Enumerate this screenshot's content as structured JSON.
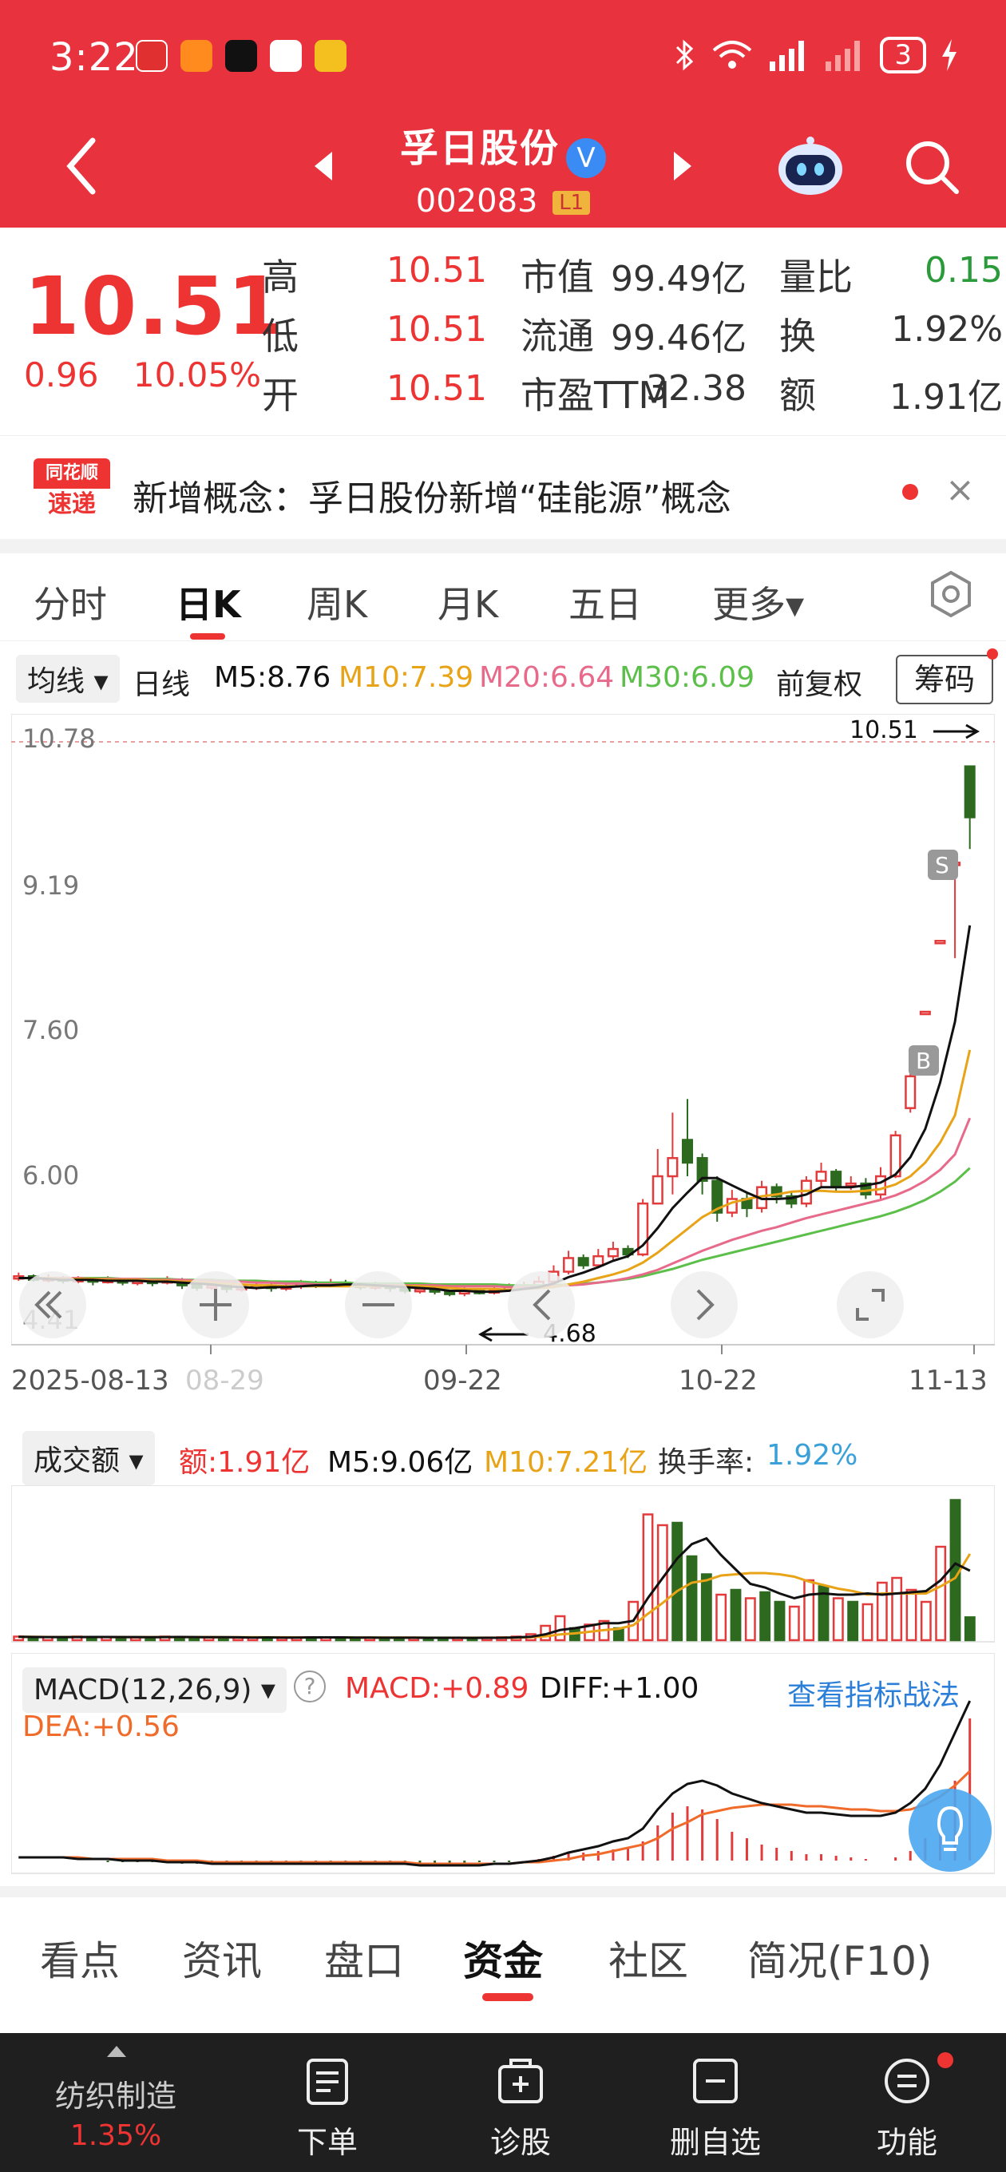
{
  "status_bar": {
    "time": "3:22",
    "battery": "3"
  },
  "header": {
    "stock_name": "孚日股份",
    "verify_mark": "V",
    "stock_code": "002083",
    "level_badge": "L1"
  },
  "quote": {
    "price": "10.51",
    "change": "0.96",
    "change_pct": "10.05%",
    "fields": {
      "high_label": "高",
      "high_value": "10.51",
      "low_label": "低",
      "low_value": "10.51",
      "open_label": "开",
      "open_value": "10.51",
      "mcap_label": "市值",
      "mcap_value": "99.49亿",
      "float_label": "流通",
      "float_value": "99.46亿",
      "pe_label": "市盈TTM",
      "pe_value": "32.38",
      "vr_label": "量比",
      "vr_value": "0.15",
      "turn_label": "换",
      "turn_value": "1.92%",
      "amt_label": "额",
      "amt_value": "1.91亿"
    }
  },
  "news": {
    "logo_line1": "同花顺",
    "logo_line2": "速递",
    "text": "新增概念：孚日股份新增“硅能源”概念",
    "close": "×"
  },
  "period_tabs": [
    "分时",
    "日K",
    "周K",
    "月K",
    "五日",
    "更多▾"
  ],
  "ma_bar": {
    "selector": "均线 ▾",
    "line": "日线",
    "m5": "M5:8.76",
    "m10": "M10:7.39",
    "m20": "M20:6.64",
    "m30": "M30:6.09",
    "adjust": "前复权",
    "chips": "筹码"
  },
  "kline": {
    "y_ticks": [
      "10.78",
      "9.19",
      "7.60",
      "6.00",
      "4.41"
    ],
    "x_ticks": [
      "2025-08-13",
      "08-29",
      "09-22",
      "10-22",
      "11-13"
    ],
    "high_mark": "10.51",
    "low_mark": "4.68",
    "b_marker": "B",
    "s_marker": "S",
    "colors": {
      "up": "#e33b3b",
      "down": "#2d6a1f",
      "m5": "#111111",
      "m10": "#e8a317",
      "m20": "#e86a8a",
      "m30": "#5cbf4a"
    }
  },
  "chart_data": {
    "type": "candlestick",
    "ylim": [
      4.41,
      10.78
    ],
    "y_ticks": [
      10.78,
      9.19,
      7.6,
      6.0,
      4.41
    ],
    "candles": [
      {
        "o": 4.88,
        "c": 4.9,
        "h": 4.94,
        "l": 4.85
      },
      {
        "o": 4.9,
        "c": 4.86,
        "h": 4.92,
        "l": 4.84
      },
      {
        "o": 4.86,
        "c": 4.88,
        "h": 4.92,
        "l": 4.83
      },
      {
        "o": 4.88,
        "c": 4.85,
        "h": 4.9,
        "l": 4.82
      },
      {
        "o": 4.85,
        "c": 4.87,
        "h": 4.9,
        "l": 4.82
      },
      {
        "o": 4.87,
        "c": 4.84,
        "h": 4.89,
        "l": 4.8
      },
      {
        "o": 4.84,
        "c": 4.86,
        "h": 4.9,
        "l": 4.82
      },
      {
        "o": 4.86,
        "c": 4.83,
        "h": 4.88,
        "l": 4.8
      },
      {
        "o": 4.83,
        "c": 4.85,
        "h": 4.88,
        "l": 4.8
      },
      {
        "o": 4.85,
        "c": 4.83,
        "h": 4.87,
        "l": 4.79
      },
      {
        "o": 4.83,
        "c": 4.86,
        "h": 4.9,
        "l": 4.81
      },
      {
        "o": 4.86,
        "c": 4.8,
        "h": 4.88,
        "l": 4.76
      },
      {
        "o": 4.8,
        "c": 4.78,
        "h": 4.83,
        "l": 4.74
      },
      {
        "o": 4.78,
        "c": 4.8,
        "h": 4.84,
        "l": 4.75
      },
      {
        "o": 4.8,
        "c": 4.76,
        "h": 4.82,
        "l": 4.72
      },
      {
        "o": 4.76,
        "c": 4.78,
        "h": 4.82,
        "l": 4.73
      },
      {
        "o": 4.78,
        "c": 4.8,
        "h": 4.84,
        "l": 4.75
      },
      {
        "o": 4.8,
        "c": 4.77,
        "h": 4.82,
        "l": 4.73
      },
      {
        "o": 4.77,
        "c": 4.79,
        "h": 4.83,
        "l": 4.74
      },
      {
        "o": 4.79,
        "c": 4.82,
        "h": 4.86,
        "l": 4.76
      },
      {
        "o": 4.82,
        "c": 4.8,
        "h": 4.85,
        "l": 4.77
      },
      {
        "o": 4.8,
        "c": 4.83,
        "h": 4.87,
        "l": 4.78
      },
      {
        "o": 4.83,
        "c": 4.81,
        "h": 4.86,
        "l": 4.78
      },
      {
        "o": 4.81,
        "c": 4.78,
        "h": 4.83,
        "l": 4.75
      },
      {
        "o": 4.78,
        "c": 4.8,
        "h": 4.84,
        "l": 4.75
      },
      {
        "o": 4.8,
        "c": 4.77,
        "h": 4.82,
        "l": 4.73
      },
      {
        "o": 4.77,
        "c": 4.74,
        "h": 4.79,
        "l": 4.71
      },
      {
        "o": 4.74,
        "c": 4.76,
        "h": 4.79,
        "l": 4.71
      },
      {
        "o": 4.76,
        "c": 4.73,
        "h": 4.78,
        "l": 4.7
      },
      {
        "o": 4.73,
        "c": 4.71,
        "h": 4.75,
        "l": 4.68
      },
      {
        "o": 4.71,
        "c": 4.74,
        "h": 4.78,
        "l": 4.68
      },
      {
        "o": 4.74,
        "c": 4.72,
        "h": 4.77,
        "l": 4.7
      },
      {
        "o": 4.72,
        "c": 4.75,
        "h": 4.79,
        "l": 4.7
      },
      {
        "o": 4.75,
        "c": 4.78,
        "h": 4.82,
        "l": 4.73
      },
      {
        "o": 4.78,
        "c": 4.8,
        "h": 4.84,
        "l": 4.76
      },
      {
        "o": 4.8,
        "c": 4.84,
        "h": 4.9,
        "l": 4.78
      },
      {
        "o": 4.84,
        "c": 4.95,
        "h": 5.02,
        "l": 4.82
      },
      {
        "o": 4.95,
        "c": 5.1,
        "h": 5.18,
        "l": 4.92
      },
      {
        "o": 5.1,
        "c": 5.02,
        "h": 5.14,
        "l": 4.98
      },
      {
        "o": 5.02,
        "c": 5.12,
        "h": 5.2,
        "l": 5.0
      },
      {
        "o": 5.12,
        "c": 5.2,
        "h": 5.28,
        "l": 5.08
      },
      {
        "o": 5.2,
        "c": 5.14,
        "h": 5.24,
        "l": 5.1
      },
      {
        "o": 5.14,
        "c": 5.7,
        "h": 5.75,
        "l": 5.12
      },
      {
        "o": 5.7,
        "c": 6.0,
        "h": 6.3,
        "l": 5.95
      },
      {
        "o": 6.0,
        "c": 6.2,
        "h": 6.7,
        "l": 5.8
      },
      {
        "o": 6.4,
        "c": 6.15,
        "h": 6.85,
        "l": 6.0
      },
      {
        "o": 6.2,
        "c": 5.95,
        "h": 6.25,
        "l": 5.8
      },
      {
        "o": 5.95,
        "c": 5.6,
        "h": 6.0,
        "l": 5.5
      },
      {
        "o": 5.6,
        "c": 5.75,
        "h": 5.85,
        "l": 5.55
      },
      {
        "o": 5.75,
        "c": 5.65,
        "h": 5.82,
        "l": 5.55
      },
      {
        "o": 5.65,
        "c": 5.88,
        "h": 5.95,
        "l": 5.6
      },
      {
        "o": 5.88,
        "c": 5.78,
        "h": 5.92,
        "l": 5.7
      },
      {
        "o": 5.78,
        "c": 5.7,
        "h": 5.84,
        "l": 5.65
      },
      {
        "o": 5.7,
        "c": 5.95,
        "h": 6.0,
        "l": 5.66
      },
      {
        "o": 5.95,
        "c": 6.05,
        "h": 6.15,
        "l": 5.88
      },
      {
        "o": 6.05,
        "c": 5.9,
        "h": 6.08,
        "l": 5.82
      },
      {
        "o": 5.9,
        "c": 5.92,
        "h": 6.0,
        "l": 5.85
      },
      {
        "o": 5.92,
        "c": 5.8,
        "h": 5.98,
        "l": 5.75
      },
      {
        "o": 5.8,
        "c": 6.0,
        "h": 6.1,
        "l": 5.75
      },
      {
        "o": 6.0,
        "c": 6.45,
        "h": 6.5,
        "l": 5.98
      },
      {
        "o": 6.75,
        "c": 7.1,
        "h": 7.2,
        "l": 6.7
      },
      {
        "o": 7.81,
        "c": 7.81,
        "h": 7.81,
        "l": 7.81
      },
      {
        "o": 8.59,
        "c": 8.59,
        "h": 8.59,
        "l": 8.59
      },
      {
        "o": 9.45,
        "c": 9.45,
        "h": 9.45,
        "l": 8.4
      },
      {
        "o": 10.51,
        "c": 9.95,
        "h": 10.51,
        "l": 9.6
      }
    ],
    "ma": {
      "m5": [
        4.88,
        4.88,
        4.87,
        4.86,
        4.86,
        4.86,
        4.85,
        4.85,
        4.85,
        4.84,
        4.84,
        4.83,
        4.82,
        4.81,
        4.79,
        4.78,
        4.77,
        4.78,
        4.78,
        4.79,
        4.8,
        4.8,
        4.81,
        4.81,
        4.8,
        4.79,
        4.78,
        4.77,
        4.76,
        4.74,
        4.74,
        4.73,
        4.73,
        4.74,
        4.76,
        4.78,
        4.82,
        4.89,
        4.94,
        5.0,
        5.07,
        5.12,
        5.24,
        5.43,
        5.65,
        5.82,
        5.98,
        5.98,
        5.9,
        5.82,
        5.75,
        5.75,
        5.76,
        5.8,
        5.88,
        5.88,
        5.88,
        5.9,
        5.93,
        6.02,
        6.21,
        6.52,
        7.03,
        7.7,
        8.76
      ],
      "m10": [
        4.88,
        4.88,
        4.88,
        4.87,
        4.87,
        4.87,
        4.86,
        4.86,
        4.86,
        4.85,
        4.85,
        4.84,
        4.84,
        4.83,
        4.82,
        4.81,
        4.8,
        4.8,
        4.79,
        4.79,
        4.79,
        4.79,
        4.79,
        4.79,
        4.79,
        4.79,
        4.79,
        4.79,
        4.78,
        4.77,
        4.76,
        4.76,
        4.76,
        4.75,
        4.76,
        4.77,
        4.78,
        4.81,
        4.84,
        4.88,
        4.92,
        4.97,
        5.05,
        5.16,
        5.29,
        5.42,
        5.55,
        5.64,
        5.71,
        5.75,
        5.78,
        5.8,
        5.83,
        5.84,
        5.84,
        5.83,
        5.83,
        5.84,
        5.86,
        5.91,
        6.0,
        6.15,
        6.37,
        6.67,
        7.39
      ],
      "m20": [
        4.88,
        4.88,
        4.88,
        4.88,
        4.88,
        4.87,
        4.87,
        4.87,
        4.87,
        4.86,
        4.86,
        4.86,
        4.85,
        4.85,
        4.84,
        4.84,
        4.83,
        4.83,
        4.82,
        4.82,
        4.81,
        4.81,
        4.81,
        4.8,
        4.8,
        4.8,
        4.8,
        4.8,
        4.8,
        4.79,
        4.79,
        4.79,
        4.79,
        4.78,
        4.78,
        4.78,
        4.79,
        4.8,
        4.81,
        4.83,
        4.85,
        4.88,
        4.92,
        4.97,
        5.04,
        5.11,
        5.18,
        5.24,
        5.3,
        5.35,
        5.4,
        5.44,
        5.49,
        5.54,
        5.58,
        5.62,
        5.66,
        5.7,
        5.74,
        5.79,
        5.86,
        5.95,
        6.07,
        6.24,
        6.64
      ],
      "m30": [
        4.88,
        4.88,
        4.88,
        4.88,
        4.88,
        4.88,
        4.88,
        4.87,
        4.87,
        4.87,
        4.87,
        4.86,
        4.86,
        4.86,
        4.85,
        4.85,
        4.85,
        4.84,
        4.84,
        4.84,
        4.83,
        4.83,
        4.83,
        4.82,
        4.82,
        4.82,
        4.82,
        4.82,
        4.81,
        4.81,
        4.81,
        4.81,
        4.81,
        4.8,
        4.8,
        4.8,
        4.8,
        4.81,
        4.82,
        4.83,
        4.85,
        4.87,
        4.9,
        4.94,
        4.98,
        5.03,
        5.08,
        5.12,
        5.16,
        5.2,
        5.24,
        5.28,
        5.32,
        5.36,
        5.4,
        5.44,
        5.48,
        5.52,
        5.56,
        5.61,
        5.67,
        5.74,
        5.83,
        5.94,
        6.09
      ]
    },
    "volume": {
      "title": "成交额",
      "values": [
        0.3,
        0.25,
        0.28,
        0.22,
        0.3,
        0.26,
        0.24,
        0.28,
        0.22,
        0.25,
        0.3,
        0.28,
        0.2,
        0.22,
        0.25,
        0.2,
        0.22,
        0.24,
        0.2,
        0.22,
        0.25,
        0.22,
        0.24,
        0.2,
        0.22,
        0.18,
        0.2,
        0.22,
        0.2,
        0.18,
        0.2,
        0.18,
        0.22,
        0.24,
        0.3,
        0.5,
        1.2,
        2.0,
        1.0,
        1.3,
        1.6,
        1.0,
        3.2,
        10.5,
        9.6,
        9.8,
        7.0,
        5.5,
        3.8,
        4.2,
        3.5,
        4.0,
        3.2,
        2.8,
        5.0,
        4.5,
        3.5,
        3.2,
        3.0,
        4.8,
        5.2,
        4.2,
        3.2,
        7.8,
        11.7,
        1.91
      ],
      "m5": [
        0.28,
        0.27,
        0.26,
        0.26,
        0.26,
        0.27,
        0.27,
        0.26,
        0.26,
        0.25,
        0.26,
        0.27,
        0.26,
        0.25,
        0.25,
        0.24,
        0.22,
        0.23,
        0.22,
        0.22,
        0.23,
        0.23,
        0.23,
        0.22,
        0.22,
        0.21,
        0.21,
        0.21,
        0.2,
        0.2,
        0.2,
        0.19,
        0.2,
        0.2,
        0.23,
        0.28,
        0.49,
        0.85,
        1.0,
        1.2,
        1.42,
        1.42,
        1.62,
        3.52,
        5.18,
        6.82,
        8.02,
        8.5,
        7.1,
        5.9,
        4.7,
        4.4,
        3.9,
        3.5,
        3.8,
        3.9,
        3.8,
        3.8,
        3.9,
        3.8,
        3.9,
        4.0,
        4.1,
        5.0,
        6.4,
        5.8
      ],
      "m10": [
        0.28,
        0.28,
        0.27,
        0.27,
        0.27,
        0.27,
        0.27,
        0.26,
        0.26,
        0.26,
        0.26,
        0.26,
        0.26,
        0.26,
        0.25,
        0.25,
        0.25,
        0.24,
        0.24,
        0.23,
        0.23,
        0.23,
        0.23,
        0.22,
        0.22,
        0.22,
        0.22,
        0.22,
        0.21,
        0.21,
        0.21,
        0.21,
        0.21,
        0.21,
        0.22,
        0.24,
        0.32,
        0.48,
        0.57,
        0.7,
        0.84,
        0.95,
        1.25,
        2.2,
        3.1,
        4.1,
        4.8,
        5.0,
        5.4,
        5.5,
        5.6,
        5.6,
        5.5,
        5.3,
        4.9,
        4.6,
        4.3,
        4.1,
        3.8,
        3.9,
        3.9,
        3.9,
        3.9,
        4.5,
        5.2,
        7.21
      ]
    },
    "macd": {
      "hist": [
        0,
        0,
        0,
        0,
        0,
        0,
        -0.01,
        -0.01,
        -0.01,
        -0.01,
        -0.01,
        -0.02,
        -0.02,
        -0.02,
        -0.02,
        -0.02,
        -0.02,
        -0.02,
        -0.02,
        -0.02,
        -0.02,
        -0.02,
        -0.02,
        -0.02,
        -0.02,
        -0.02,
        -0.02,
        -0.02,
        -0.02,
        -0.02,
        -0.02,
        -0.01,
        -0.01,
        -0.01,
        0.0,
        0.01,
        0.03,
        0.05,
        0.05,
        0.06,
        0.07,
        0.08,
        0.12,
        0.22,
        0.3,
        0.34,
        0.32,
        0.26,
        0.18,
        0.14,
        0.1,
        0.08,
        0.06,
        0.04,
        0.04,
        0.03,
        0.02,
        0.01,
        0.0,
        0.02,
        0.06,
        0.14,
        0.28,
        0.5,
        0.89
      ],
      "diff": [
        0.02,
        0.02,
        0.02,
        0.02,
        0.01,
        0.01,
        0.01,
        0.0,
        0.0,
        0.0,
        -0.01,
        -0.01,
        -0.01,
        -0.02,
        -0.02,
        -0.02,
        -0.02,
        -0.02,
        -0.02,
        -0.02,
        -0.02,
        -0.02,
        -0.02,
        -0.02,
        -0.02,
        -0.02,
        -0.02,
        -0.03,
        -0.03,
        -0.03,
        -0.03,
        -0.03,
        -0.02,
        -0.02,
        -0.01,
        0.0,
        0.02,
        0.05,
        0.07,
        0.09,
        0.12,
        0.14,
        0.2,
        0.32,
        0.42,
        0.48,
        0.5,
        0.47,
        0.42,
        0.39,
        0.36,
        0.34,
        0.32,
        0.3,
        0.3,
        0.29,
        0.28,
        0.28,
        0.28,
        0.3,
        0.36,
        0.45,
        0.6,
        0.8,
        1.0
      ],
      "dea": [
        0.02,
        0.02,
        0.02,
        0.02,
        0.02,
        0.01,
        0.01,
        0.01,
        0.01,
        0.01,
        0.0,
        0.0,
        0.0,
        -0.01,
        -0.01,
        -0.01,
        -0.01,
        -0.01,
        -0.01,
        -0.01,
        -0.01,
        -0.01,
        -0.01,
        -0.01,
        -0.01,
        -0.01,
        -0.01,
        -0.02,
        -0.02,
        -0.02,
        -0.02,
        -0.02,
        -0.02,
        -0.02,
        -0.01,
        -0.01,
        0.0,
        0.01,
        0.03,
        0.04,
        0.06,
        0.08,
        0.1,
        0.14,
        0.2,
        0.24,
        0.29,
        0.31,
        0.33,
        0.34,
        0.35,
        0.35,
        0.35,
        0.34,
        0.34,
        0.33,
        0.32,
        0.32,
        0.31,
        0.31,
        0.32,
        0.35,
        0.4,
        0.47,
        0.56
      ]
    }
  },
  "volume_bar": {
    "selector": "成交额 ▾",
    "amt": "额:1.91亿",
    "m5": "M5:9.06亿",
    "m10": "M10:7.21亿",
    "turnover_label": "换手率:",
    "turnover_value": "1.92%"
  },
  "macd_bar": {
    "selector": "MACD(12,26,9) ▾",
    "help": "?",
    "macd": "MACD:+0.89",
    "diff": "DIFF:+1.00",
    "dea": "DEA:+0.56",
    "strategy_link": "查看指标战法"
  },
  "bottom_tabs": [
    "看点",
    "资讯",
    "盘口",
    "资金",
    "社区",
    "简况(F10)"
  ],
  "actions": {
    "sector_name": "纺织制造",
    "sector_pct": "1.35%",
    "order": "下单",
    "diagnose": "诊股",
    "remove": "删自选",
    "func": "功能"
  }
}
